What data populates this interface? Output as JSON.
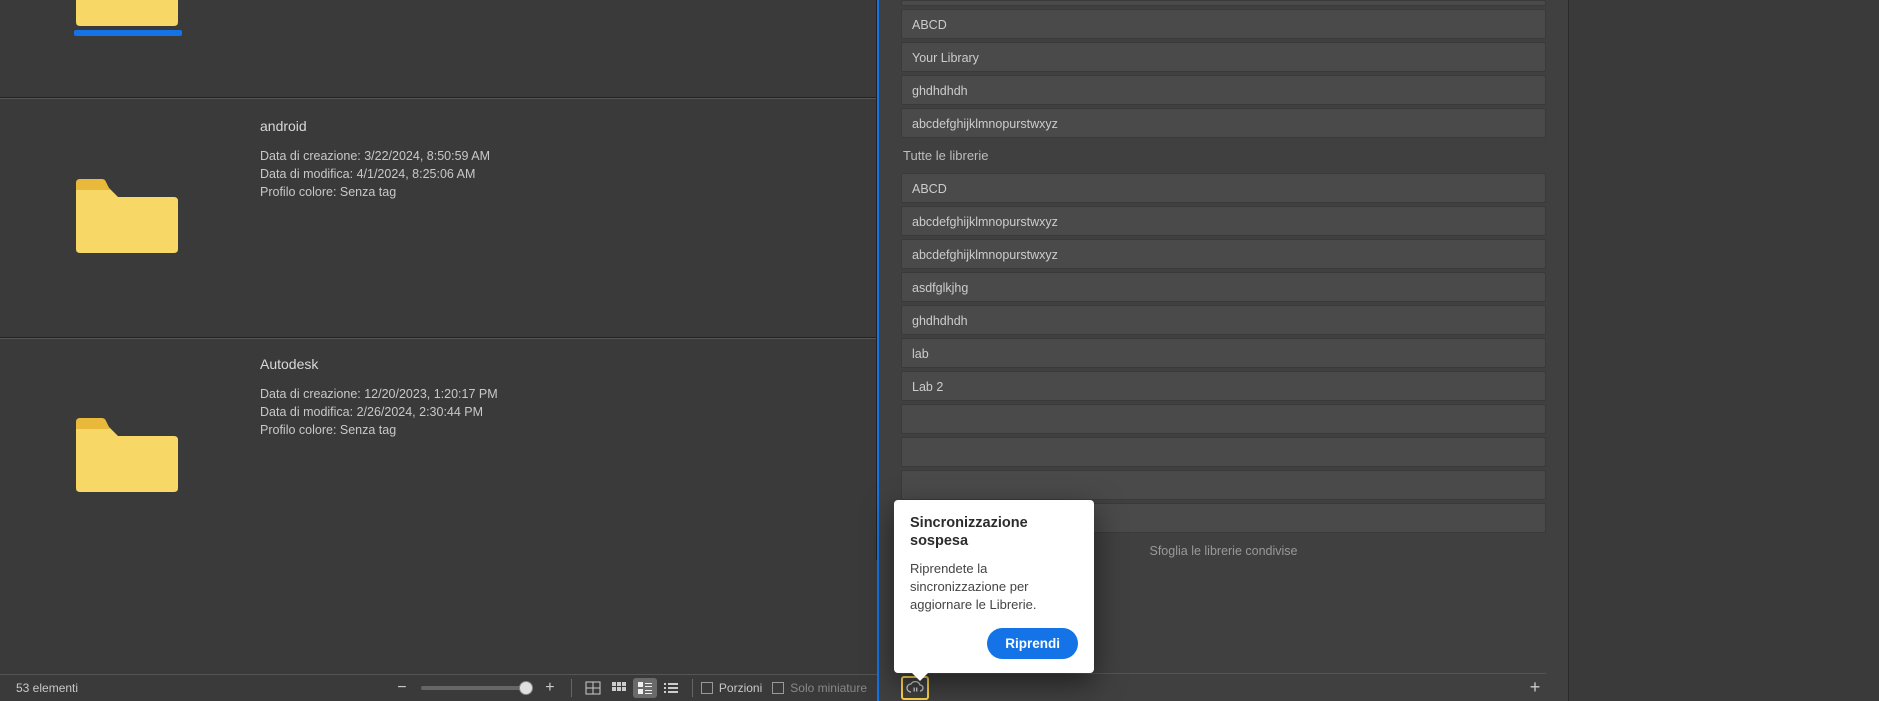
{
  "left": {
    "items": [
      {
        "name": "android",
        "creation": "Data di creazione: 3/22/2024, 8:50:59 AM",
        "modified": "Data di modifica: 4/1/2024, 8:25:06 AM",
        "profile": "Profilo colore: Senza tag"
      },
      {
        "name": "Autodesk",
        "creation": "Data di creazione: 12/20/2023, 1:20:17 PM",
        "modified": "Data di modifica: 2/26/2024, 2:30:44 PM",
        "profile": "Profilo colore: Senza tag"
      }
    ],
    "selected_index": 0
  },
  "bottom": {
    "count": "53 elementi",
    "porzioni": "Porzioni",
    "solo_miniature": "Solo miniature"
  },
  "libs": {
    "top": [
      "ABCD",
      "Your Library",
      "ghdhdhdh",
      "abcdefghijklmnopurstwxyz"
    ],
    "section": "Tutte le librerie",
    "all": [
      "ABCD",
      "abcdefghijklmnopurstwxyz",
      "abcdefghijklmnopurstwxyz",
      "asdfglkjhg",
      "ghdhdhdh",
      "lab",
      "Lab 2",
      "",
      "",
      "",
      ""
    ],
    "browse": "Sfoglia le librerie condivise"
  },
  "popover": {
    "title": "Sincronizzazione sospesa",
    "body": "Riprendete la sincronizzazione per aggiornare le Librerie.",
    "button": "Riprendi"
  },
  "colors": {
    "accent": "#1473e6",
    "warning": "#ffd54a"
  }
}
